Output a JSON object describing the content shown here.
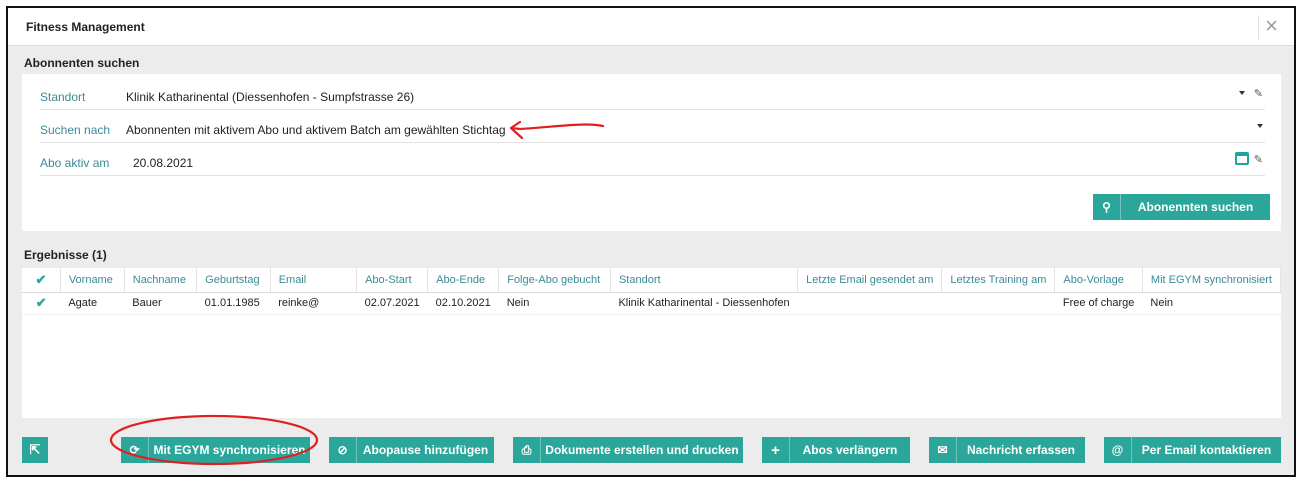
{
  "window": {
    "title": "Fitness Management",
    "close_glyph": "×"
  },
  "search": {
    "section_title": "Abonnenten suchen",
    "fields": {
      "standort": {
        "label": "Standort",
        "value": "Klinik Katharinental (Diessenhofen - Sumpfstrasse 26)"
      },
      "suchen_nach": {
        "label": "Suchen nach",
        "value": "Abonnenten mit aktivem Abo und aktivem Batch am gewählten Stichtag"
      },
      "abo_aktiv_am": {
        "label": "Abo aktiv am",
        "value": "20.08.2021"
      }
    },
    "button_label": "Abonennten suchen",
    "button_icon": "search-icon"
  },
  "results": {
    "section_title": "Ergebnisse (1)",
    "columns": [
      "Vorname",
      "Nachname",
      "Geburtstag",
      "Email",
      "Abo-Start",
      "Abo-Ende",
      "Folge-Abo gebucht",
      "Standort",
      "Letzte Email gesendet am",
      "Letztes Training am",
      "Abo-Vorlage",
      "Mit EGYM synchronisiert"
    ],
    "rows": [
      [
        "Agate",
        "Bauer",
        "01.01.1985",
        "reinke@",
        "02.07.2021",
        "02.10.2021",
        "Nein",
        "Klinik Katharinental - Diessenhofen",
        "",
        "",
        "Free of charge",
        "Nein"
      ]
    ]
  },
  "toolbar": {
    "export_icon": "export-icon",
    "sync_label": "Mit EGYM synchronisieren",
    "pause_label": "Abopause hinzufügen",
    "docs_label": "Dokumente erstellen und drucken",
    "extend_label": "Abos verlängern",
    "message_label": "Nachricht erfassen",
    "email_label": "Per Email kontaktieren"
  },
  "colors": {
    "accent": "#2aa79a",
    "label": "#3c8a96",
    "annotation": "#e02020"
  }
}
